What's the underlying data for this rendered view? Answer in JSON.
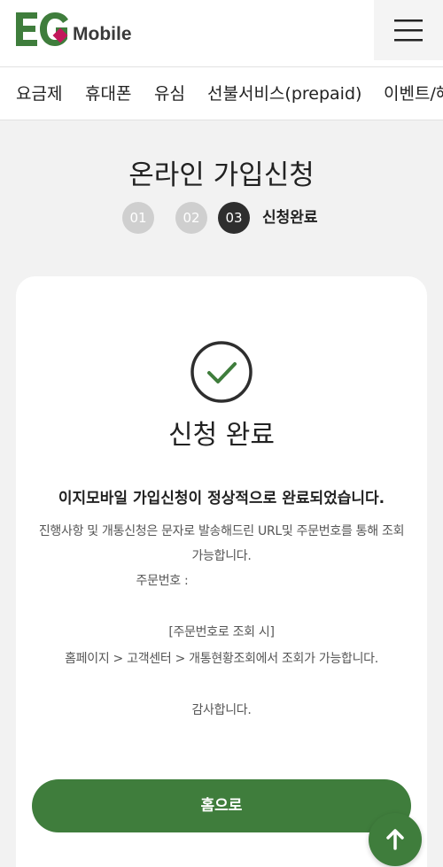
{
  "header": {
    "logo_text": "Mobile",
    "brand_color": "#3f7d3c"
  },
  "nav": {
    "items": [
      "요금제",
      "휴대폰",
      "유심",
      "선불서비스(prepaid)",
      "이벤트/혜"
    ]
  },
  "page": {
    "title": "온라인 가입신청",
    "steps": [
      "01",
      "02",
      "03"
    ],
    "current_step_label": "신청완료"
  },
  "result": {
    "title": "신청 완료",
    "message": "이지모바일 가입신청이 정상적으로 완료되었습니다.",
    "desc_line1": "진행사항 및 개통신청은 문자로 발송해드린 URL및 주문번호를 통해 조회",
    "desc_line2": "가능합니다.",
    "order_label": "주문번호 :",
    "inquiry_label": "[주문번호로 조회 시]",
    "inquiry_path": "홈페이지 > 고객센터 > 개통현황조회에서 조회가 가능합니다.",
    "thanks": "감사합니다."
  },
  "actions": {
    "home_label": "홈으로"
  },
  "icons": {
    "menu": "hamburger-icon",
    "check": "check-circle-icon",
    "top": "arrow-up-icon"
  }
}
